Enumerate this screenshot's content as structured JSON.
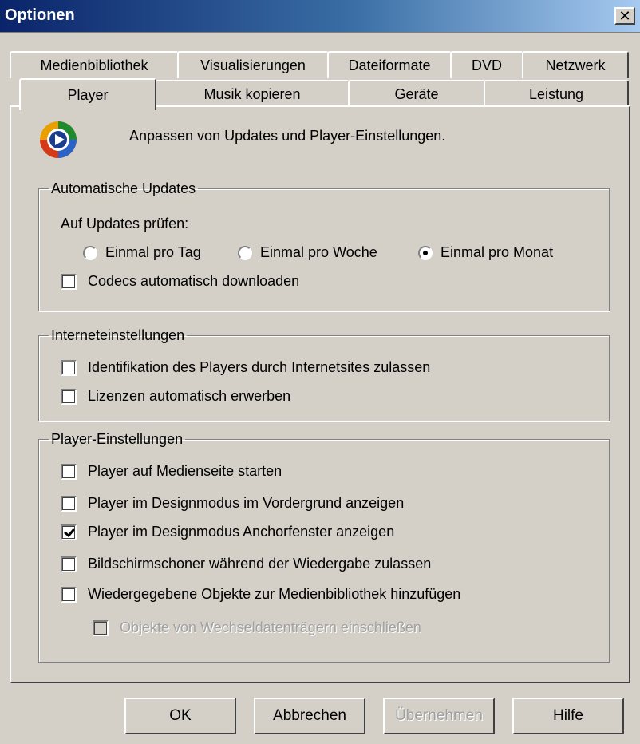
{
  "window": {
    "title": "Optionen",
    "close_label": "✕"
  },
  "tabs": {
    "row1": [
      "Medienbibliothek",
      "Visualisierungen",
      "Dateiformate",
      "DVD",
      "Netzwerk"
    ],
    "row2": [
      "Player",
      "Musik kopieren",
      "Geräte",
      "Leistung"
    ],
    "active": "Player"
  },
  "intro": {
    "icon": "windows-media-player-icon",
    "text": "Anpassen von Updates und Player-Einstellungen."
  },
  "auto_updates": {
    "legend": "Automatische Updates",
    "check_label": "Auf Updates prüfen:",
    "options": [
      "Einmal pro Tag",
      "Einmal pro Woche",
      "Einmal pro Monat"
    ],
    "selected": "Einmal pro Monat",
    "codecs_label": "Codecs automatisch downloaden",
    "codecs_checked": false
  },
  "internet": {
    "legend": "Interneteinstellungen",
    "identification_label": "Identifikation des Players durch Internetsites zulassen",
    "identification_checked": false,
    "licenses_label": "Lizenzen automatisch erwerben",
    "licenses_checked": false
  },
  "player": {
    "legend": "Player-Einstellungen",
    "start_media_label": "Player auf Medienseite starten",
    "start_media_checked": false,
    "foreground_label": "Player im Designmodus im Vordergrund anzeigen",
    "foreground_checked": false,
    "anchor_label": "Player im Designmodus Anchorfenster anzeigen",
    "anchor_checked": true,
    "screensaver_label": "Bildschirmschoner während der Wiedergabe zulassen",
    "screensaver_checked": false,
    "add_items_label": "Wiedergegebene Objekte zur Medienbibliothek hinzufügen",
    "add_items_checked": false,
    "removable_label": "Objekte von Wechseldatenträgern einschließen",
    "removable_checked": false,
    "removable_enabled": false
  },
  "buttons": {
    "ok": "OK",
    "cancel": "Abbrechen",
    "apply": "Übernehmen",
    "apply_enabled": false,
    "help": "Hilfe"
  },
  "colors": {
    "title_start": "#0a246a",
    "title_end": "#a6caf0",
    "face": "#d4d0c8"
  }
}
